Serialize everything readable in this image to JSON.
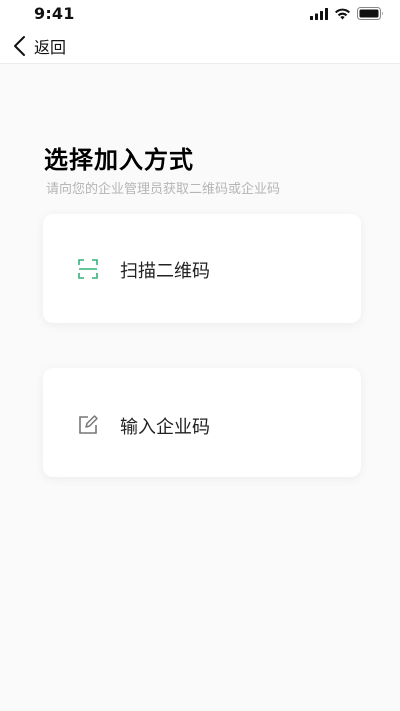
{
  "status_bar": {
    "time": "9:41"
  },
  "nav": {
    "back_label": "返回"
  },
  "page": {
    "title": "选择加入方式",
    "subtitle": "请向您的企业管理员获取二维码或企业码"
  },
  "options": [
    {
      "label": "扫描二维码",
      "icon": "qr-scan-icon"
    },
    {
      "label": "输入企业码",
      "icon": "edit-icon"
    }
  ],
  "colors": {
    "accent_green": "#34b27a",
    "icon_gray": "#777777",
    "subtitle_gray": "#b5b5b5"
  }
}
